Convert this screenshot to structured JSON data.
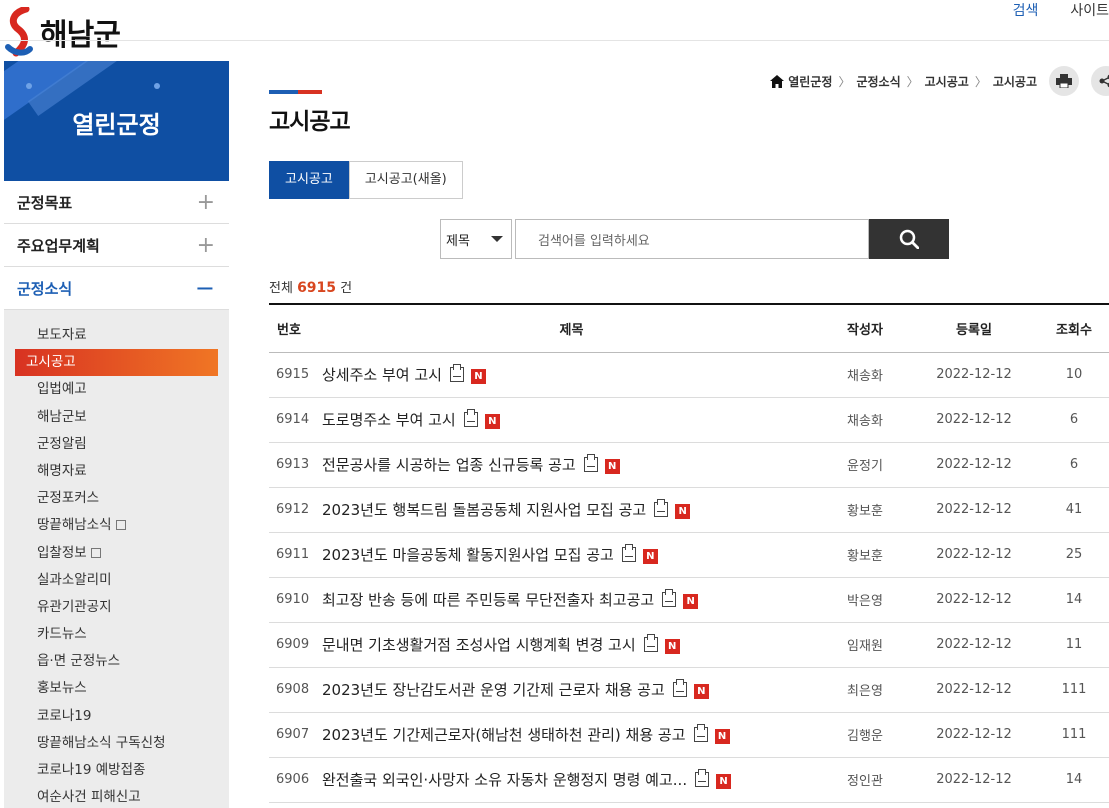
{
  "header": {
    "logo_text": "해남군",
    "links": [
      "검색",
      "사이트"
    ]
  },
  "sidebar": {
    "title": "열린군정",
    "categories": [
      {
        "label": "군정목표",
        "symbol": "+"
      },
      {
        "label": "주요업무계획",
        "symbol": "+"
      },
      {
        "label": "군정소식",
        "symbol": "−"
      }
    ],
    "items": [
      "보도자료",
      "고시공고",
      "입법예고",
      "해남군보",
      "군정알림",
      "해명자료",
      "군정포커스",
      "땅끝해남소식",
      "입찰정보",
      "실과소알리미",
      "유관기관공지",
      "카드뉴스",
      "읍·면 군정뉴스",
      "홍보뉴스",
      "코로나19",
      "땅끝해남소식 구독신청",
      "코로나19 예방접종",
      "여순사건 피해신고"
    ],
    "current_item": "고시공고",
    "external_items": [
      "땅끝해남소식",
      "입찰정보"
    ]
  },
  "breadcrumb": [
    "열린군정",
    "군정소식",
    "고시공고",
    "고시공고"
  ],
  "page_title": "고시공고",
  "tabs": [
    "고시공고",
    "고시공고(새올)"
  ],
  "search": {
    "select_value": "제목",
    "placeholder": "검색어를 입력하세요"
  },
  "total": {
    "prefix": "전체",
    "count": "6915",
    "suffix": "건"
  },
  "table": {
    "headers": {
      "num": "번호",
      "title": "제목",
      "writer": "작성자",
      "date": "등록일",
      "views": "조회수"
    },
    "rows": [
      {
        "num": "6915",
        "title": "상세주소 부여 고시",
        "writer": "채송화",
        "date": "2022-12-12",
        "views": "10"
      },
      {
        "num": "6914",
        "title": "도로명주소 부여 고시",
        "writer": "채송화",
        "date": "2022-12-12",
        "views": "6"
      },
      {
        "num": "6913",
        "title": "전문공사를 시공하는 업종 신규등록 공고",
        "writer": "윤정기",
        "date": "2022-12-12",
        "views": "6"
      },
      {
        "num": "6912",
        "title": "2023년도 행복드림 돌봄공동체 지원사업 모집 공고",
        "writer": "황보훈",
        "date": "2022-12-12",
        "views": "41"
      },
      {
        "num": "6911",
        "title": "2023년도 마을공동체 활동지원사업 모집 공고",
        "writer": "황보훈",
        "date": "2022-12-12",
        "views": "25"
      },
      {
        "num": "6910",
        "title": "최고장 반송 등에 따른 주민등록 무단전출자 최고공고",
        "writer": "박은영",
        "date": "2022-12-12",
        "views": "14"
      },
      {
        "num": "6909",
        "title": "문내면 기초생활거점 조성사업 시행계획 변경 고시",
        "writer": "임재원",
        "date": "2022-12-12",
        "views": "11"
      },
      {
        "num": "6908",
        "title": "2023년도 장난감도서관 운영 기간제 근로자 채용 공고",
        "writer": "최은영",
        "date": "2022-12-12",
        "views": "111"
      },
      {
        "num": "6907",
        "title": "2023년도 기간제근로자(해남천 생태하천 관리) 채용 공고",
        "writer": "김행운",
        "date": "2022-12-12",
        "views": "111"
      },
      {
        "num": "6906",
        "title": "완전출국 외국인·사망자 소유 자동차 운행정지 명령 예고...",
        "writer": "정인관",
        "date": "2022-12-12",
        "views": "14"
      }
    ],
    "new_badge": "N"
  },
  "colors": {
    "primary": "#0f4fa3",
    "accent": "#d83222",
    "count": "#d8461f"
  },
  "icons": {
    "home": "home-icon",
    "print": "print-icon",
    "share": "share-icon",
    "search": "search-icon",
    "attachment": "attachment-icon"
  }
}
